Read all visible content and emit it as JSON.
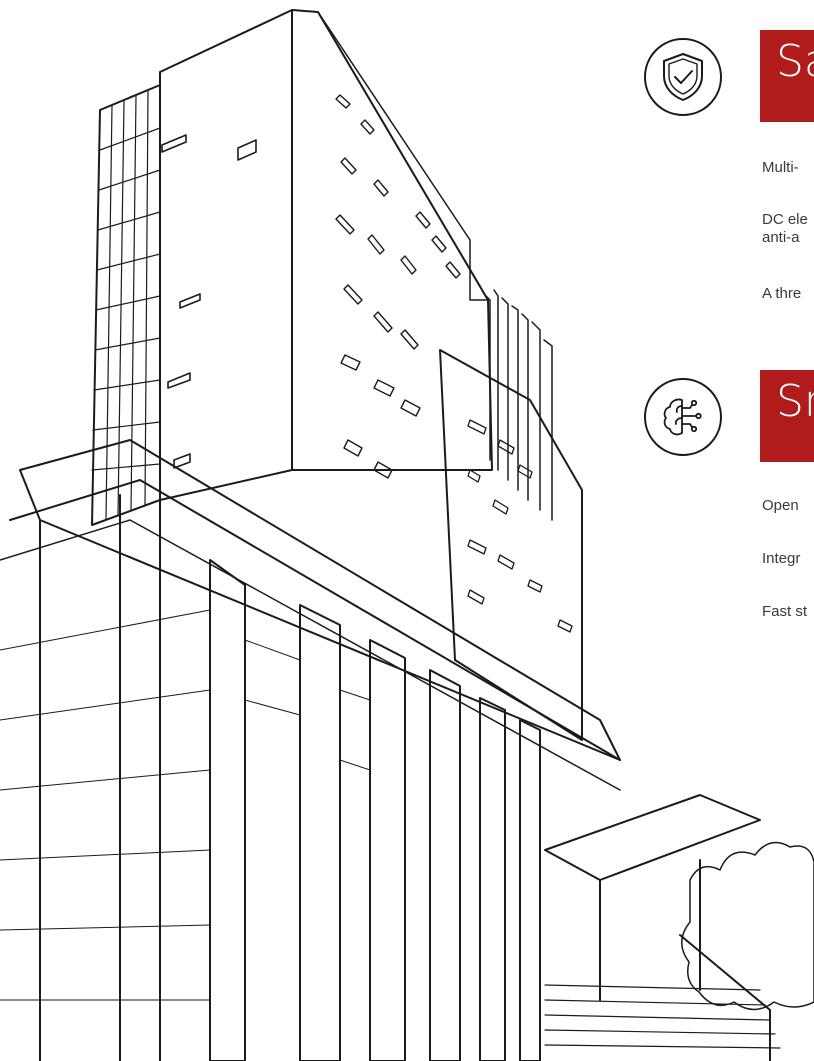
{
  "sections": [
    {
      "title": "Sa",
      "icon": "shield-check-icon",
      "lines": [
        "Multi-",
        "DC ele",
        "anti-a",
        "A thre"
      ]
    },
    {
      "title": "Sn",
      "icon": "brain-circuit-icon",
      "lines": [
        "Open",
        "Integr",
        "Fast st"
      ]
    }
  ],
  "colors": {
    "accent": "#b01c1c",
    "line": "#1b1b1b"
  }
}
